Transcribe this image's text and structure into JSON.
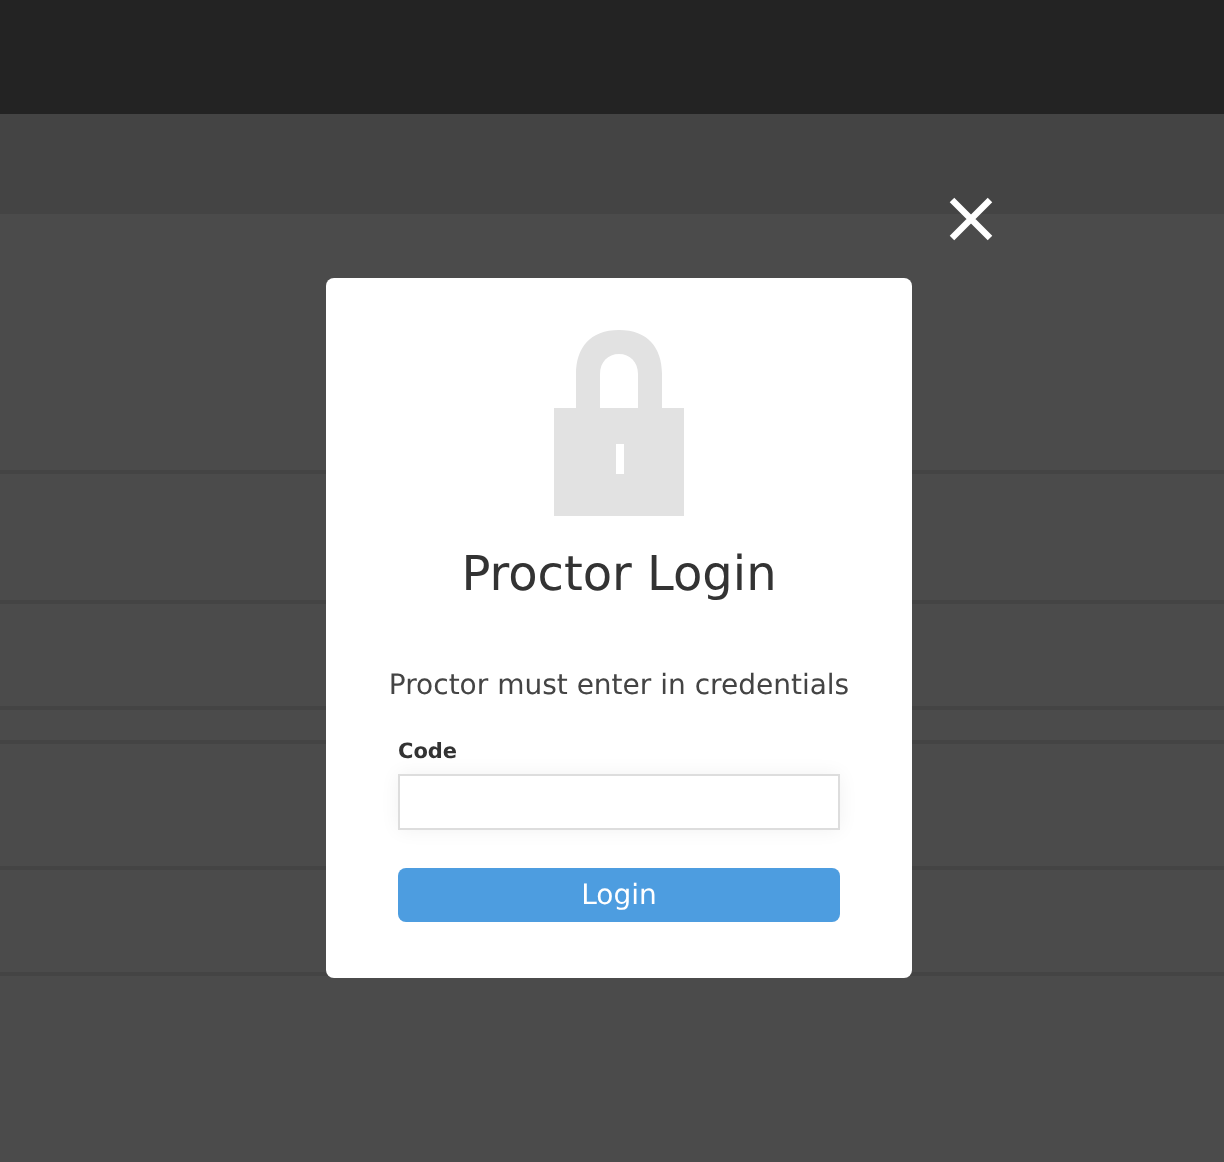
{
  "dialog": {
    "title": "Proctor Login",
    "message": "Proctor must enter in credentials",
    "code_field": {
      "label": "Code"
    },
    "login_button": {
      "label": "Login"
    }
  }
}
